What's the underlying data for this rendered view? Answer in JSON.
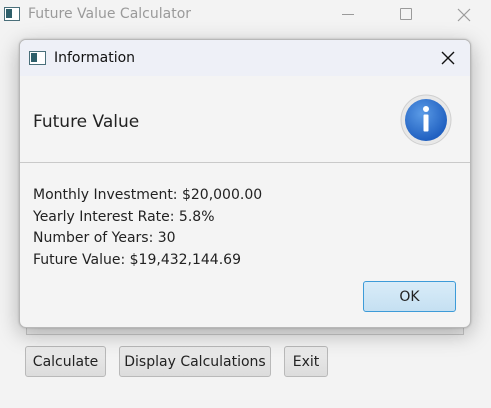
{
  "main_window": {
    "title": "Future Value Calculator",
    "buttons": {
      "calculate": "Calculate",
      "display_calculations": "Display Calculations",
      "exit": "Exit"
    }
  },
  "dialog": {
    "title": "Information",
    "header": "Future Value",
    "icon": "info-icon",
    "lines": [
      "Monthly Investment: $20,000.00",
      "Yearly Interest Rate: 5.8%",
      "Number of Years: 30",
      "Future Value: $19,432,144.69"
    ],
    "ok_label": "OK",
    "accent_color": "#3d9bd8"
  }
}
